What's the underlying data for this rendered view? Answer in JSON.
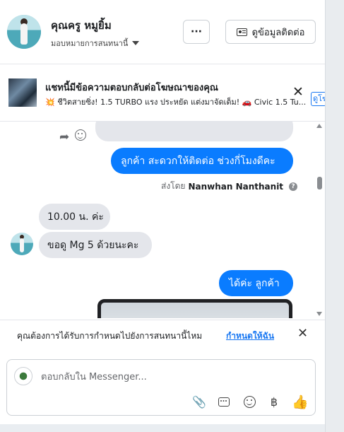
{
  "header": {
    "name": "คุณครู หมูยิ้ม",
    "assign_label": "มอบหมายการสนทนานี้",
    "more_label": "···",
    "contact_label": "ดูข้อมูลติดต่อ"
  },
  "ad": {
    "title": "แชทนี้มีข้อความตอบกลับต่อโฆษณาของคุณ",
    "subtitle_fire": "💥",
    "subtitle": " ชีวิตสายซิ่ง! 1.5 TURBO แรง ประหยัด แต่งมาจัดเต็ม! 🚗 Civic 1.5 Tu...",
    "close": "✕",
    "link": "ดูโฆ"
  },
  "conversation": {
    "messages": [
      {
        "from": "page",
        "text": "ลูกค้า สะดวกให้ติดต่อ ช่วงกี่โมงดีคะ"
      },
      {
        "from": "customer",
        "text": "10.00 น. ค่ะ"
      },
      {
        "from": "customer",
        "text": "ขอดู Mg 5 ด้วยนะคะ"
      },
      {
        "from": "page",
        "text": "ได้ค่ะ  ลูกค้า"
      }
    ],
    "sent_by_prefix": "ส่งโดย",
    "sent_by_name": "Nanwhan Nanthanit",
    "help": "?"
  },
  "prompt": {
    "text": "คุณต้องการได้รับการกำหนดไปยังการสนทนานี้ไหม",
    "link": "กำหนดให้ฉัน",
    "close": "✕"
  },
  "composer": {
    "placeholder": "ตอบกลับใน Messenger...",
    "icons": [
      "paperclip-icon",
      "saved-reply-icon",
      "emoji-icon",
      "baht-icon",
      "like-icon"
    ],
    "baht_glyph": "฿",
    "clip_glyph": "📎",
    "like_glyph": "👍"
  },
  "colors": {
    "accent": "#0a7cff",
    "link": "#1877f2",
    "bubble_gray": "#e4e6eb"
  }
}
